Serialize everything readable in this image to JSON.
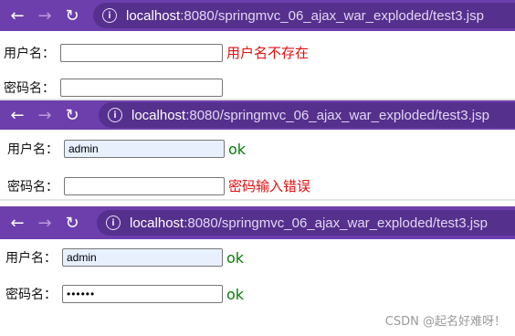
{
  "screens": [
    {
      "url_host": "localhost",
      "url_rest": ":8080/springmvc_06_ajax_war_exploded/test3.jsp",
      "username_label": "用户名：",
      "username_value": "",
      "username_msg": "用户名不存在",
      "password_label": "密码名：",
      "password_value": "",
      "password_msg": ""
    },
    {
      "url_host": "localhost",
      "url_rest": ":8080/springmvc_06_ajax_war_exploded/test3.jsp",
      "username_label": "用户名：",
      "username_value": "admin",
      "username_msg": "ok",
      "password_label": "密码名：",
      "password_value": "",
      "password_msg": "密码输入错误"
    },
    {
      "url_host": "localhost",
      "url_rest": ":8080/springmvc_06_ajax_war_exploded/test3.jsp",
      "username_label": "用户名：",
      "username_value": "admin",
      "username_msg": "ok",
      "password_label": "密码名：",
      "password_value": "••••••",
      "password_msg": "ok"
    }
  ],
  "nav": {
    "back_glyph": "←",
    "forward_glyph": "→",
    "reload_glyph": "↻",
    "info_glyph": "i"
  },
  "watermark": "CSDN @起名好难呀！",
  "colors": {
    "toolbar": "#6d3fad",
    "omnibox": "#55308d",
    "error": "#e01010",
    "ok": "#0a7a0a",
    "autofill": "#e8f0fe"
  }
}
